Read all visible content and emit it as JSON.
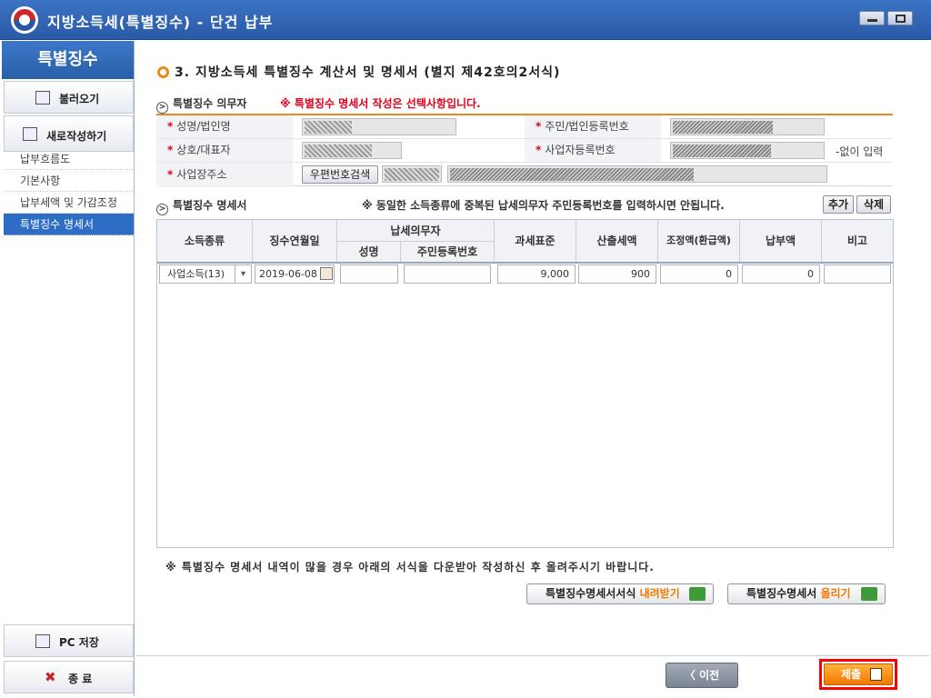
{
  "window": {
    "title": "지방소득세(특별징수) - 단건 납부"
  },
  "sidebar": {
    "header": "특별징수",
    "import_label": "불러오기",
    "new_label": "새로작성하기",
    "menu": [
      {
        "label": "납부흐름도",
        "active": false
      },
      {
        "label": "기본사항",
        "active": false
      },
      {
        "label": "납부세액 및 가감조정",
        "active": false
      },
      {
        "label": "특별징수 명세서",
        "active": true
      }
    ],
    "save_label": "PC 저장",
    "exit_label": "종 료"
  },
  "main": {
    "section_title": "3. 지방소득세 특별징수 계산서 및 명세서 (별지 제42호의2서식)",
    "obligor": {
      "heading": "특별징수 의무자",
      "note": "※ 특별징수 명세서 작성은 선택사항입니다.",
      "labels": {
        "name": "성명/법인명",
        "reg_no": "주민/법인등록번호",
        "company": "상호/대표자",
        "biz_no": "사업자등록번호",
        "address": "사업장주소"
      },
      "biz_no_hint": "-없이 입력",
      "zip_button": "우편번호검색"
    },
    "statement": {
      "heading": "특별징수 명세서",
      "note": "※ 동일한 소득종류에 중복된 납세의무자 주민등록번호를 입력하시면 안됩니다.",
      "add_button": "추가",
      "delete_button": "삭제",
      "columns": {
        "income_type": "소득종류",
        "collect_date": "징수연월일",
        "taxpayer": "납세의무자",
        "taxpayer_name": "성명",
        "taxpayer_id": "주민등록번호",
        "tax_base": "과세표준",
        "calc_tax": "산출세액",
        "adjust": "조정액(환급액)",
        "pay_amount": "납부액",
        "remark": "비고"
      },
      "rows": [
        {
          "income_type": "사업소득(13)",
          "collect_date": "2019-06-08",
          "tax_base": "9,000",
          "calc_tax": "900",
          "adjust": "0",
          "pay_amount": "0",
          "remark": ""
        }
      ]
    },
    "footnote": "※ 특별징수 명세서 내역이 많을 경우 아래의 서식을 다운받아 작성하신 후 올려주시기 바랍니다.",
    "download_prefix": "특별징수명세서서식",
    "download_highlight": "내려받기",
    "upload_prefix": "특별징수명세서",
    "upload_highlight": "올리기"
  },
  "footer": {
    "prev_label": "〈 이전",
    "submit_label": "제출"
  },
  "colors": {
    "accent": "#e8891e",
    "brand": "#2d6dc6",
    "warning": "#e2001a",
    "submit": "#f07800",
    "highlight_border": "#ff0000"
  }
}
